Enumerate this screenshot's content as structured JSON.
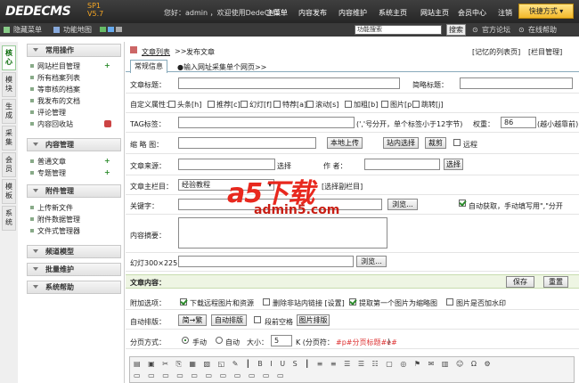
{
  "header": {
    "logo": "DEDECMS",
    "version_tag": "SP1",
    "version": "V5.7",
    "welcome": "您好：admin ，欢迎使用DedeCMS！",
    "nav": [
      "主菜单",
      "内容发布",
      "内容维护",
      "系统主页",
      "网站主页",
      "会员中心",
      "注销"
    ],
    "quick": "快捷方式"
  },
  "toolbar": {
    "hide_menu": "隐藏菜单",
    "site_map": "功能地图",
    "search_placeholder": "功能搜索",
    "search_btn": "搜索",
    "forum": "官方论坛",
    "help": "在线帮助"
  },
  "vtabs": [
    "核心",
    "模块",
    "生成",
    "采集",
    "会员",
    "模板",
    "系统"
  ],
  "sidebar": {
    "sections": [
      {
        "title": "常用操作",
        "items": [
          "网站栏目管理",
          "所有档案列表",
          "等审核的档案",
          "我发布的文档",
          "评论管理",
          "内容回收站"
        ]
      },
      {
        "title": "内容管理",
        "items": [
          "普通文章",
          "专题管理"
        ]
      },
      {
        "title": "附件管理",
        "items": [
          "上传新文件",
          "附件数据管理",
          "文件式管理器"
        ]
      },
      {
        "title": "频道模型",
        "items": []
      },
      {
        "title": "批量维护",
        "items": []
      },
      {
        "title": "系统帮助",
        "items": []
      }
    ]
  },
  "main": {
    "breadcrumb": [
      "文章列表",
      ">>",
      "发布文章"
    ],
    "remember": "[记忆的列表页]",
    "col_manage": "[栏目管理]",
    "tabs": {
      "basic": "常规信息",
      "import": "●输入网址采集单个网页>>"
    },
    "title_label": "文章标题：",
    "short_title_label": "简略标题：",
    "attr_label": "自定义属性：",
    "attrs": [
      "头条[h]",
      "推荐[c]",
      "幻灯[f]",
      "特荐[a]",
      "滚动[s]",
      "加粗[b]",
      "图片[p]",
      "跳转[j]"
    ],
    "tag_label": "TAG标签：",
    "tag_hint": "(','号分开，单个标签小于12字节)",
    "weight_label": "权重：",
    "weight_value": "86",
    "weight_hint": "(越小越靠前)",
    "thumb_label": "缩 略 图：",
    "upload": "本地上传",
    "site_select": "站内选择",
    "crop": "裁剪",
    "remote": "远程",
    "source_label": "文章来源：",
    "source_select": "选择",
    "author_label": "作 者：",
    "author_select": "选择",
    "column_label": "文章主栏目：",
    "column_value": "经验教程",
    "sub_column": "[选择副栏目]",
    "keywords_label": "关键字：",
    "browse": "浏览...",
    "auto_get": "自动获取，手动填写用\",\"分开",
    "summary_label": "内容摘要：",
    "slide_label": "幻灯300×225：",
    "content_label": "文章内容：",
    "save": "保存",
    "reset": "重置",
    "options_label": "附加选项：",
    "opts": [
      "下载远程图片和资源",
      "删除非站内链接 [设置]",
      "提取第一个图片为缩略图",
      "图片是否加水印"
    ],
    "format_label": "自动排版：",
    "fmt_buttons": [
      "简→繁",
      "自动排版"
    ],
    "first_space": "段前空格",
    "img_format": "图片排版",
    "paging_label": "分页方式：",
    "manual": "手动",
    "auto": "自动",
    "size_label": "大小：",
    "size_value": "5",
    "size_unit": "K (分页符：",
    "page_mark": "#p#分页标题#e#",
    "close_paren": ")"
  },
  "watermark": {
    "big": "a5下载",
    "url": "admin5.com"
  }
}
